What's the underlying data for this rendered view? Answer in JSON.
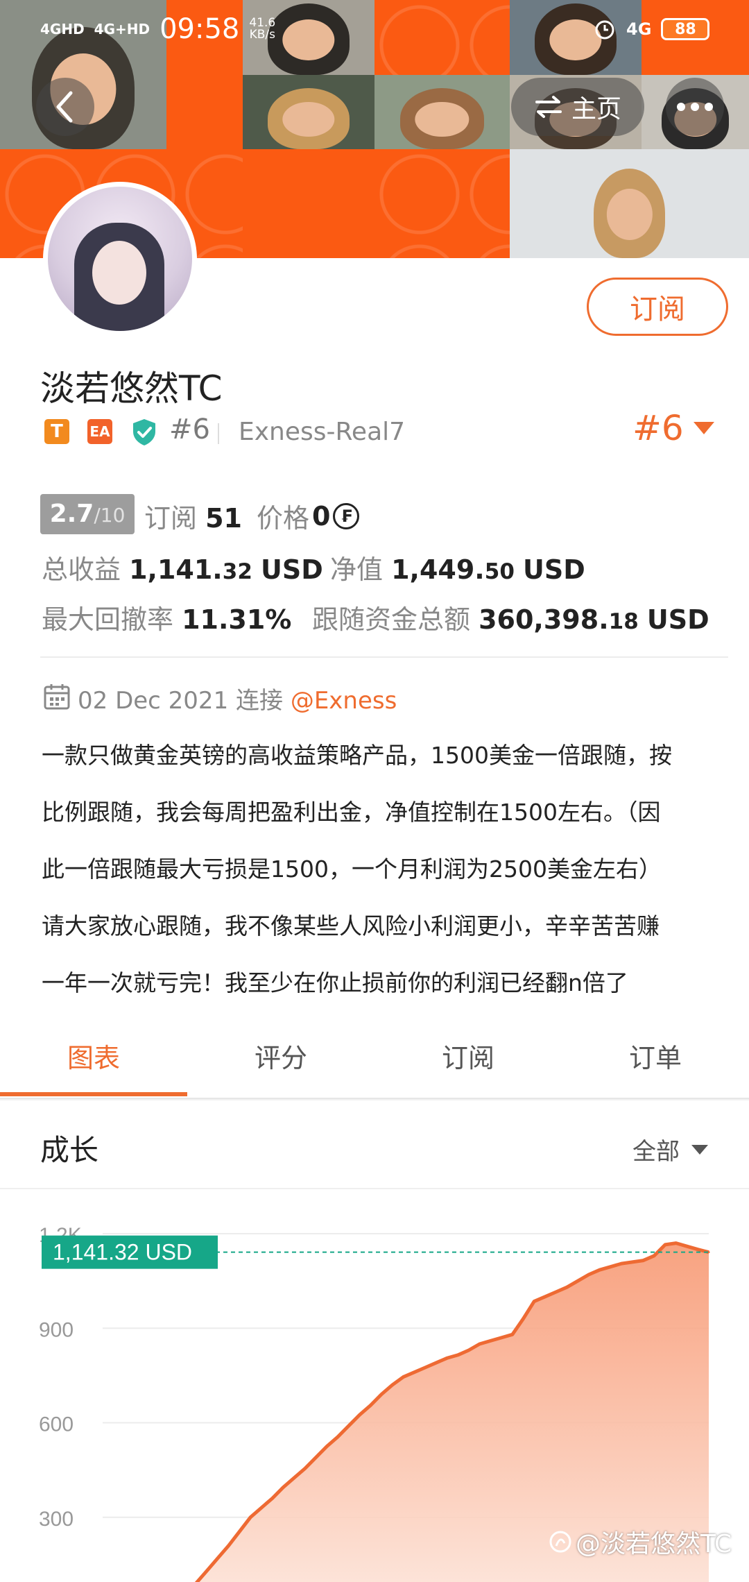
{
  "status_bar": {
    "signal_1": "4GHD",
    "signal_2": "4G+HD",
    "time": "09:58",
    "speed_value": "41.6",
    "speed_unit": "KB/s",
    "network": "4G",
    "battery": "88"
  },
  "header": {
    "home_label": "主页"
  },
  "profile": {
    "subscribe_label": "订阅",
    "name": "淡若悠然TC",
    "badge_t": "T",
    "badge_ea": "EA",
    "rank": "#6",
    "account": "Exness-Real7",
    "rank_dropdown": "#6"
  },
  "stats": {
    "score_main": "2.7",
    "score_sub": "/10",
    "subscribe_label": "订阅",
    "subscribe_count": "51",
    "price_label": "价格",
    "price_value": "0",
    "price_currency_symbol": "₣",
    "total_profit_label": "总收益",
    "total_profit_int": "1,141.",
    "total_profit_dec": "32",
    "total_profit_unit": "USD",
    "equity_label": "净值",
    "equity_int": "1,449.",
    "equity_dec": "50",
    "equity_unit": "USD",
    "drawdown_label": "最大回撤率",
    "drawdown_value": "11.31%",
    "follow_funds_label": "跟随资金总额",
    "follow_funds_int": "360,398.",
    "follow_funds_dec": "18",
    "follow_funds_unit": "USD"
  },
  "connection": {
    "date": "02 Dec 2021",
    "connect_label": "连接",
    "broker": "@Exness"
  },
  "description": [
    "一款只做黄金英镑的高收益策略产品，1500美金一倍跟随，按",
    "比例跟随，我会每周把盈利出金，净值控制在1500左右。（因",
    "此一倍跟随最大亏损是1500，一个月利润为2500美金左右）",
    "请大家放心跟随，我不像某些人风险小利润更小，辛辛苦苦赚",
    "一年一次就亏完！我至少在你止损前你的利润已经翻n倍了"
  ],
  "tabs": [
    "图表",
    "评分",
    "订阅",
    "订单"
  ],
  "growth": {
    "title": "成长",
    "filter_label": "全部"
  },
  "watermark": "@淡若悠然TC",
  "colors": {
    "brand_orange": "#ef6c2f",
    "badge_t": "#f28a1e",
    "badge_ea": "#f2622a",
    "shield": "#2fb7a3",
    "current_value_tag": "#16a788"
  },
  "chart_data": {
    "type": "area",
    "title": "",
    "xlabel": "",
    "ylabel": "",
    "ylim": [
      0,
      1200
    ],
    "y_ticks": [
      "1.2K",
      "900",
      "600",
      "300"
    ],
    "current_label": "1,141.32 USD",
    "current_value": 1141.32,
    "series": [
      {
        "values": [
          0,
          5,
          15,
          30,
          45,
          60,
          90,
          130,
          170,
          210,
          255,
          300,
          330,
          360,
          395,
          425,
          455,
          490,
          525,
          555,
          590,
          625,
          655,
          690,
          720,
          745,
          760,
          775,
          790,
          805,
          815,
          830,
          850,
          860,
          870,
          880,
          930,
          985,
          1000,
          1015,
          1030,
          1050,
          1070,
          1085,
          1095,
          1105,
          1110,
          1115,
          1130,
          1165,
          1170,
          1160,
          1150,
          1141.32
        ]
      }
    ]
  }
}
